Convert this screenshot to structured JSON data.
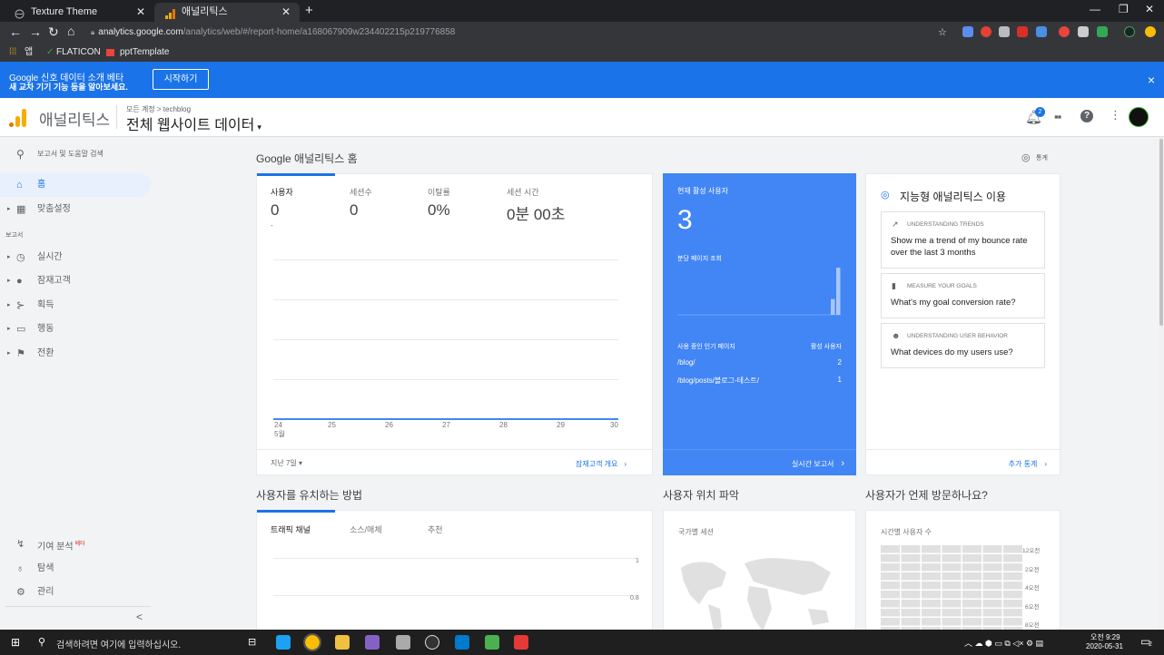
{
  "browser": {
    "tabs": [
      {
        "label": "Texture Theme"
      },
      {
        "label": "애널리틱스"
      }
    ],
    "new_tab": "+",
    "url_host": "analytics.google.com",
    "url_path": "/analytics/web/#/report-home/a168067909w234402215p219776858",
    "bookmarks": [
      {
        "label": "앱"
      },
      {
        "label": "FLATICON"
      },
      {
        "label": "pptTemplate"
      }
    ]
  },
  "banner": {
    "line1": "Google 신호 데이터 소개 베타",
    "line2": "새 교차 기기 기능 등을 알아보세요.",
    "button": "시작하기",
    "close": "×"
  },
  "header": {
    "app_title": "애널리틱스",
    "breadcrumb": "모든 계정 > techblog",
    "view_name": "전체 웹사이트 데이터",
    "notification_count": "2"
  },
  "sidebar": {
    "search_placeholder": "보고서 및 도움말 검색",
    "home": "홈",
    "custom": "맞춤설정",
    "section_reports": "보고서",
    "realtime": "실시간",
    "audience": "잠재고객",
    "acquisition": "획득",
    "behavior": "행동",
    "conversions": "전환",
    "attribution": "기여 분석",
    "attribution_badge": "베타",
    "discover": "탐색",
    "admin": "관리",
    "collapse": "<"
  },
  "home": {
    "title": "Google 애널리틱스 홈",
    "insights_link": "통계",
    "metrics": [
      {
        "label": "사용자",
        "value": "0",
        "sub": "-"
      },
      {
        "label": "세션수",
        "value": "0"
      },
      {
        "label": "이탈률",
        "value": "0%"
      },
      {
        "label": "세션 시간",
        "value": "0분 00초"
      }
    ],
    "x_ticks": [
      "24",
      "25",
      "26",
      "27",
      "28",
      "29",
      "30"
    ],
    "x_month": "5월",
    "date_range": "지난 7일 ▾",
    "audience_link": "잠재고객 개요"
  },
  "realtime": {
    "title": "현재 활성 사용자",
    "value": "3",
    "pageviews_label": "분당 페이지 조회",
    "bars": [
      0,
      0,
      0,
      0,
      0,
      0,
      0,
      0,
      0,
      0,
      0,
      0,
      0,
      0,
      0,
      0,
      0,
      0,
      0,
      0,
      0,
      0,
      0,
      0,
      0,
      0,
      0,
      0,
      1,
      3
    ],
    "table_header": [
      "사용 중인 인기 페이지",
      "활성 사용자"
    ],
    "rows": [
      {
        "page": "/blog/",
        "users": "2"
      },
      {
        "page": "/blog/posts/블로그-테스트/",
        "users": "1"
      }
    ],
    "link": "실시간 보고서"
  },
  "intelligence": {
    "title": "지능형 애널리틱스 이용",
    "cards": [
      {
        "category": "UNDERSTANDING TRENDS",
        "question": "Show me a trend of my bounce rate over the last 3 months"
      },
      {
        "category": "MEASURE YOUR GOALS",
        "question": "What's my goal conversion rate?"
      },
      {
        "category": "UNDERSTANDING USER BEHAVIOR",
        "question": "What devices do my users use?"
      }
    ],
    "link": "추가 통계"
  },
  "sections": {
    "acquire_title": "사용자를 유치하는 방법",
    "acquire_tabs": [
      "트래픽 채널",
      "소스/매체",
      "추천"
    ],
    "acquire_y": [
      "1",
      "0.8"
    ],
    "location_title": "사용자 위치 파악",
    "location_label": "국가별 세션",
    "when_title": "사용자가 언제 방문하나요?",
    "when_label": "시간별 사용자 수",
    "when_hours": [
      "12오전",
      "2오전",
      "4오전",
      "6오전",
      "8오전"
    ]
  },
  "taskbar": {
    "search": "검색하려면 여기에 입력하십시오.",
    "time": "오전 9:29",
    "date": "2020-05-31",
    "notify": "2"
  },
  "colors": {
    "accent": "#1a73e8",
    "realtime_bg": "#4285f4",
    "ga_orange": "#f9ab00",
    "ga_dark_orange": "#e37400"
  }
}
